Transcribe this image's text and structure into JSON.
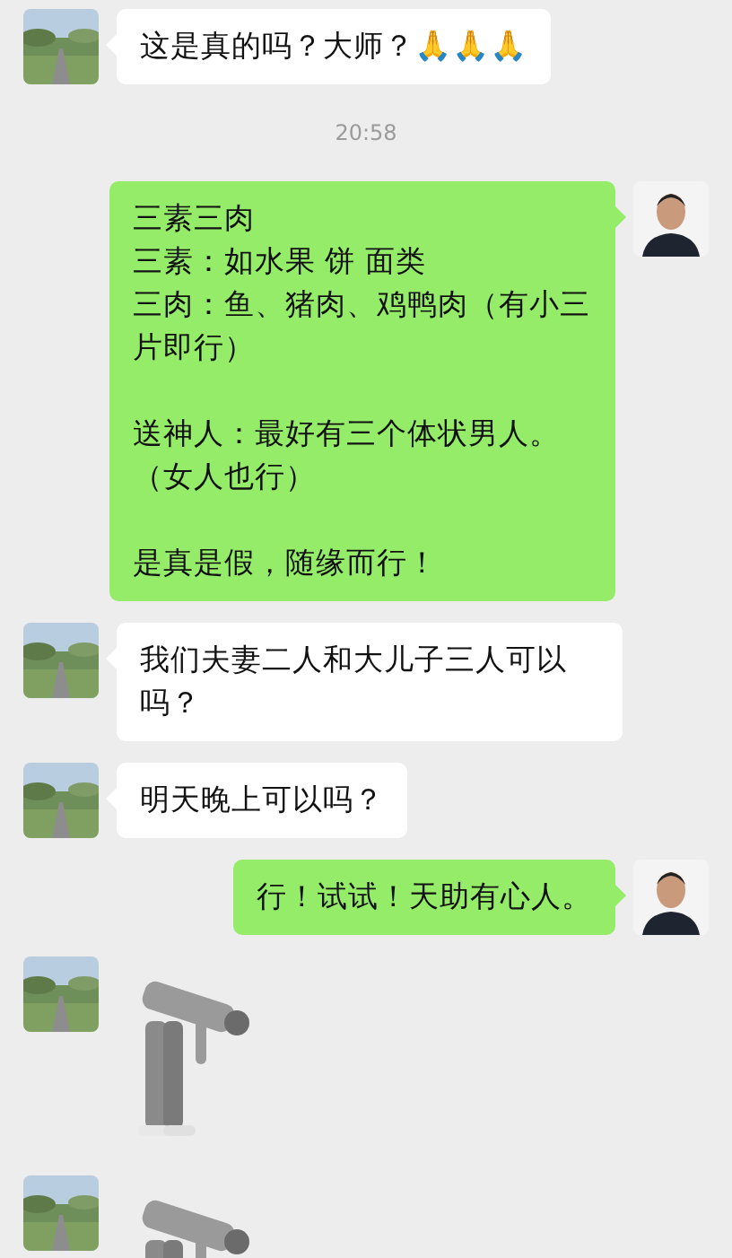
{
  "messages": [
    {
      "kind": "incoming_text",
      "paragraphs": [
        [
          "这是真的吗？大师？"
        ]
      ],
      "emoji": "🙏🙏🙏"
    },
    {
      "kind": "time",
      "text": "20:58"
    },
    {
      "kind": "outgoing_text",
      "paragraphs": [
        [
          "三素三肉",
          "三素：如水果 饼 面类",
          "三肉：鱼、猪肉、鸡鸭肉（有小三片即行）"
        ],
        [
          "送神人：最好有三个体状男人。（女人也行）"
        ],
        [
          "是真是假，随缘而行！"
        ]
      ]
    },
    {
      "kind": "incoming_text",
      "paragraphs": [
        [
          "我们夫妻二人和大儿子三人可以吗？"
        ]
      ]
    },
    {
      "kind": "incoming_text",
      "paragraphs": [
        [
          "明天晚上可以吗？"
        ]
      ]
    },
    {
      "kind": "outgoing_text",
      "paragraphs": [
        [
          "行！试试！天助有心人。"
        ]
      ]
    },
    {
      "kind": "incoming_sticker"
    },
    {
      "kind": "incoming_sticker"
    }
  ]
}
